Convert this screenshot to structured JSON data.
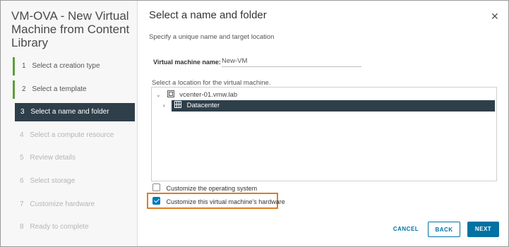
{
  "wizard": {
    "title": "VM-OVA - New Virtual Machine from Content Library",
    "steps": [
      {
        "num": "1",
        "label": "Select a creation type",
        "state": "done"
      },
      {
        "num": "2",
        "label": "Select a template",
        "state": "done"
      },
      {
        "num": "3",
        "label": "Select a name and folder",
        "state": "active"
      },
      {
        "num": "4",
        "label": "Select a compute resource",
        "state": "disabled"
      },
      {
        "num": "5",
        "label": "Review details",
        "state": "disabled"
      },
      {
        "num": "6",
        "label": "Select storage",
        "state": "disabled"
      },
      {
        "num": "7",
        "label": "Customize hardware",
        "state": "disabled"
      },
      {
        "num": "8",
        "label": "Ready to complete",
        "state": "disabled"
      }
    ]
  },
  "dialog": {
    "title": "Select a name and folder",
    "close_icon": "close-icon",
    "subtitle": "Specify a unique name and target location",
    "vm_name_label": "Virtual machine name:",
    "vm_name_value": "New-VM",
    "location_label": "Select a location for the virtual machine.",
    "tree": {
      "vcenter": {
        "label": "vcenter-01.vmw.lab",
        "icon": "vcenter-icon",
        "expanded": true
      },
      "datacenter": {
        "label": "Datacenter",
        "icon": "datacenter-icon",
        "selected": true,
        "expanded": false
      }
    },
    "options": {
      "customize_os": {
        "label": "Customize the operating system",
        "checked": false
      },
      "customize_hw": {
        "label": "Customize this virtual machine's hardware",
        "checked": true
      }
    },
    "buttons": {
      "cancel": "CANCEL",
      "back": "BACK",
      "next": "NEXT"
    }
  },
  "colors": {
    "accent": "#0072a3",
    "selected_bg": "#2e3f4a",
    "done_marker": "#5c9e3a",
    "highlight_border": "#e07b25"
  }
}
